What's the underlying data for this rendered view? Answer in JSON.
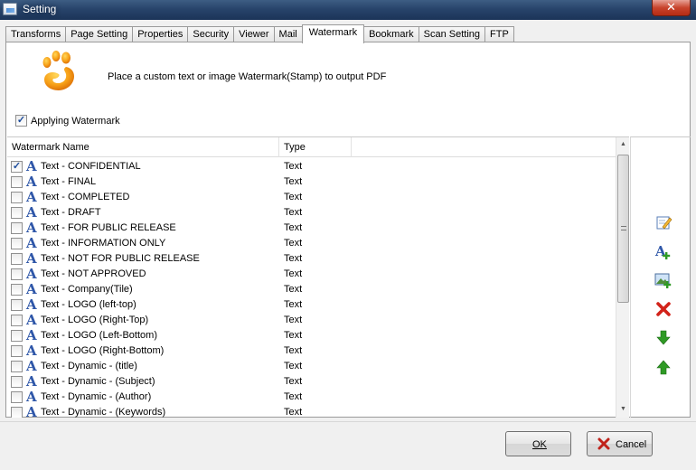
{
  "window": {
    "title": "Setting",
    "close_glyph": "✕"
  },
  "tabs": [
    {
      "label": "Transforms"
    },
    {
      "label": "Page Setting"
    },
    {
      "label": "Properties"
    },
    {
      "label": "Security"
    },
    {
      "label": "Viewer"
    },
    {
      "label": "Mail"
    },
    {
      "label": "Watermark",
      "active": true
    },
    {
      "label": "Bookmark"
    },
    {
      "label": "Scan Setting"
    },
    {
      "label": "FTP"
    }
  ],
  "watermark": {
    "description": "Place a custom text or image Watermark(Stamp) to output PDF",
    "applying_label": "Applying Watermark",
    "applying_checked": true,
    "list": {
      "columns": {
        "name": "Watermark Name",
        "type": "Type"
      },
      "rows": [
        {
          "name": "Text - CONFIDENTIAL",
          "type": "Text",
          "checked": true
        },
        {
          "name": "Text - FINAL",
          "type": "Text",
          "checked": false
        },
        {
          "name": "Text - COMPLETED",
          "type": "Text",
          "checked": false
        },
        {
          "name": "Text - DRAFT",
          "type": "Text",
          "checked": false
        },
        {
          "name": "Text - FOR PUBLIC RELEASE",
          "type": "Text",
          "checked": false
        },
        {
          "name": "Text - INFORMATION ONLY",
          "type": "Text",
          "checked": false
        },
        {
          "name": "Text - NOT FOR PUBLIC RELEASE",
          "type": "Text",
          "checked": false
        },
        {
          "name": "Text - NOT APPROVED",
          "type": "Text",
          "checked": false
        },
        {
          "name": "Text - Company(Tile)",
          "type": "Text",
          "checked": false
        },
        {
          "name": "Text - LOGO (left-top)",
          "type": "Text",
          "checked": false
        },
        {
          "name": "Text - LOGO (Right-Top)",
          "type": "Text",
          "checked": false
        },
        {
          "name": "Text - LOGO (Left-Bottom)",
          "type": "Text",
          "checked": false
        },
        {
          "name": "Text - LOGO (Right-Bottom)",
          "type": "Text",
          "checked": false
        },
        {
          "name": "Text - Dynamic - (title)",
          "type": "Text",
          "checked": false
        },
        {
          "name": "Text - Dynamic - (Subject)",
          "type": "Text",
          "checked": false
        },
        {
          "name": "Text - Dynamic - (Author)",
          "type": "Text",
          "checked": false
        },
        {
          "name": "Text - Dynamic - (Keywords)",
          "type": "Text",
          "checked": false
        }
      ]
    },
    "tools": [
      "edit-icon",
      "add-text-watermark-icon",
      "add-image-watermark-icon",
      "delete-icon",
      "move-down-icon",
      "move-up-icon"
    ]
  },
  "buttons": {
    "ok": "OK",
    "cancel": "Cancel"
  },
  "colors": {
    "title_bar": "#28446b",
    "accent_blue": "#2e56a8",
    "delete_red": "#d2231a",
    "arrow_green": "#2f9a25"
  }
}
